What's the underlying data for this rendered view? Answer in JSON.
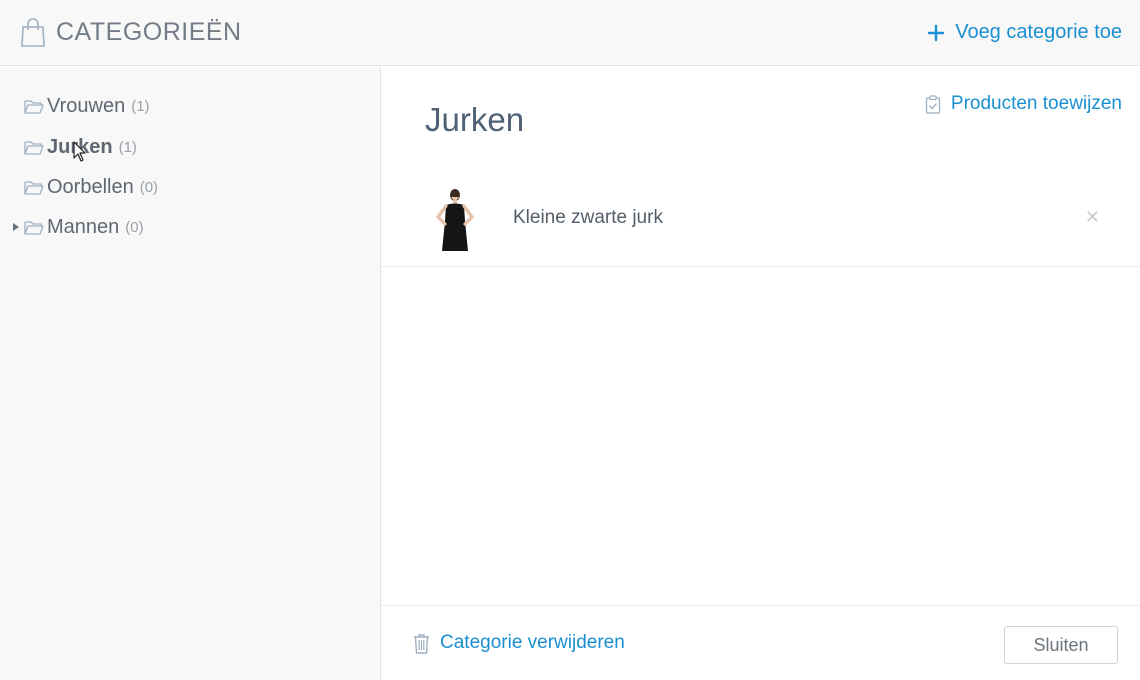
{
  "header": {
    "title": "CATEGORIEËN",
    "title_icon": "shopping-bag-icon",
    "add_category_label": "Voeg categorie toe",
    "add_icon": "plus-icon"
  },
  "sidebar": {
    "items": [
      {
        "label": "Vrouwen",
        "count": "(1)",
        "expandable": false,
        "selected": false
      },
      {
        "label": "Jurken",
        "count": "(1)",
        "expandable": false,
        "selected": true
      },
      {
        "label": "Oorbellen",
        "count": "(0)",
        "expandable": false,
        "selected": false
      },
      {
        "label": "Mannen",
        "count": "(0)",
        "expandable": true,
        "selected": false
      }
    ]
  },
  "main": {
    "title": "Jurken",
    "assign_label": "Producten toewijzen",
    "assign_icon": "clipboard-check-icon",
    "products": [
      {
        "name": "Kleine zwarte jurk",
        "remove_icon": "close-icon"
      }
    ]
  },
  "footer": {
    "delete_label": "Categorie verwijderen",
    "delete_icon": "trash-icon",
    "close_label": "Sluiten"
  },
  "colors": {
    "accent": "#1a8fd1",
    "header_bg": "#f8f8f8",
    "text": "#5f6872",
    "muted": "#9aa1a9"
  }
}
